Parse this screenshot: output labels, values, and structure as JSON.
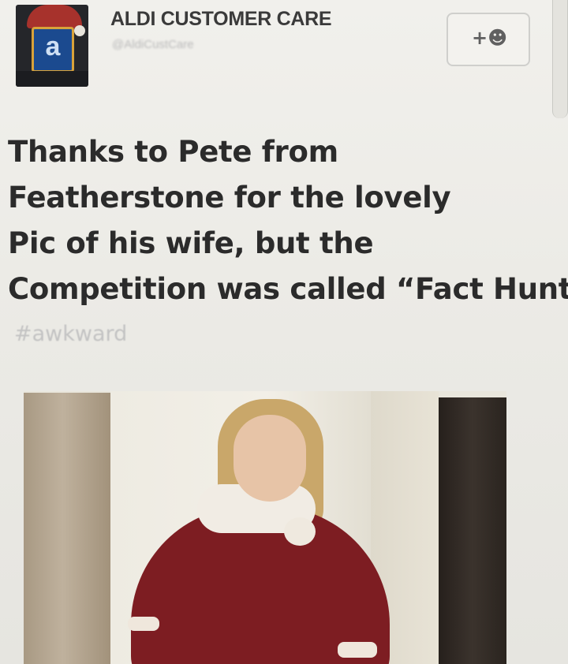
{
  "header": {
    "display_name": "ALDI CUSTOMER CARE",
    "handle": "@AldiCustCare",
    "follow_icon": "add-person-icon",
    "follow_glyph": "+☻",
    "avatar_letter": "a"
  },
  "tweet": {
    "lines": [
      "Thanks to Pete from",
      "Featherstone for the lovely",
      "Pic of his wife, but the",
      "Competition was called “Fact Hunt”"
    ],
    "hashtag": "#awkward"
  },
  "colors": {
    "background": "#ecebe6",
    "text": "#2b2b2b",
    "hashtag": "#c3c3c3",
    "dress": "#7d1d22"
  }
}
